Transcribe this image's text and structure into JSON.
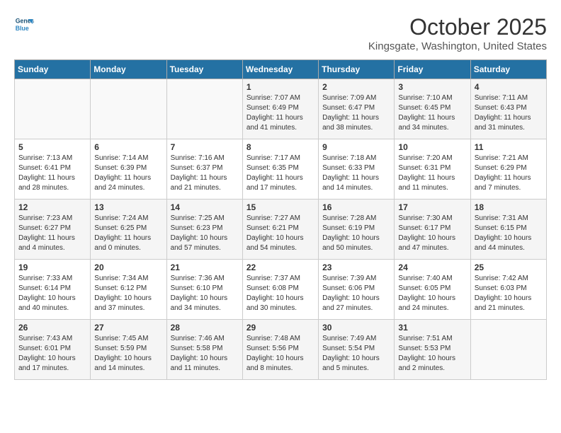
{
  "header": {
    "logo_line1": "General",
    "logo_line2": "Blue",
    "month": "October 2025",
    "location": "Kingsgate, Washington, United States"
  },
  "days_of_week": [
    "Sunday",
    "Monday",
    "Tuesday",
    "Wednesday",
    "Thursday",
    "Friday",
    "Saturday"
  ],
  "weeks": [
    [
      {
        "day": "",
        "empty": true
      },
      {
        "day": "",
        "empty": true
      },
      {
        "day": "",
        "empty": true
      },
      {
        "day": "1",
        "sunrise": "7:07 AM",
        "sunset": "6:49 PM",
        "daylight": "11 hours and 41 minutes."
      },
      {
        "day": "2",
        "sunrise": "7:09 AM",
        "sunset": "6:47 PM",
        "daylight": "11 hours and 38 minutes."
      },
      {
        "day": "3",
        "sunrise": "7:10 AM",
        "sunset": "6:45 PM",
        "daylight": "11 hours and 34 minutes."
      },
      {
        "day": "4",
        "sunrise": "7:11 AM",
        "sunset": "6:43 PM",
        "daylight": "11 hours and 31 minutes."
      }
    ],
    [
      {
        "day": "5",
        "sunrise": "7:13 AM",
        "sunset": "6:41 PM",
        "daylight": "11 hours and 28 minutes."
      },
      {
        "day": "6",
        "sunrise": "7:14 AM",
        "sunset": "6:39 PM",
        "daylight": "11 hours and 24 minutes."
      },
      {
        "day": "7",
        "sunrise": "7:16 AM",
        "sunset": "6:37 PM",
        "daylight": "11 hours and 21 minutes."
      },
      {
        "day": "8",
        "sunrise": "7:17 AM",
        "sunset": "6:35 PM",
        "daylight": "11 hours and 17 minutes."
      },
      {
        "day": "9",
        "sunrise": "7:18 AM",
        "sunset": "6:33 PM",
        "daylight": "11 hours and 14 minutes."
      },
      {
        "day": "10",
        "sunrise": "7:20 AM",
        "sunset": "6:31 PM",
        "daylight": "11 hours and 11 minutes."
      },
      {
        "day": "11",
        "sunrise": "7:21 AM",
        "sunset": "6:29 PM",
        "daylight": "11 hours and 7 minutes."
      }
    ],
    [
      {
        "day": "12",
        "sunrise": "7:23 AM",
        "sunset": "6:27 PM",
        "daylight": "11 hours and 4 minutes."
      },
      {
        "day": "13",
        "sunrise": "7:24 AM",
        "sunset": "6:25 PM",
        "daylight": "11 hours and 0 minutes."
      },
      {
        "day": "14",
        "sunrise": "7:25 AM",
        "sunset": "6:23 PM",
        "daylight": "10 hours and 57 minutes."
      },
      {
        "day": "15",
        "sunrise": "7:27 AM",
        "sunset": "6:21 PM",
        "daylight": "10 hours and 54 minutes."
      },
      {
        "day": "16",
        "sunrise": "7:28 AM",
        "sunset": "6:19 PM",
        "daylight": "10 hours and 50 minutes."
      },
      {
        "day": "17",
        "sunrise": "7:30 AM",
        "sunset": "6:17 PM",
        "daylight": "10 hours and 47 minutes."
      },
      {
        "day": "18",
        "sunrise": "7:31 AM",
        "sunset": "6:15 PM",
        "daylight": "10 hours and 44 minutes."
      }
    ],
    [
      {
        "day": "19",
        "sunrise": "7:33 AM",
        "sunset": "6:14 PM",
        "daylight": "10 hours and 40 minutes."
      },
      {
        "day": "20",
        "sunrise": "7:34 AM",
        "sunset": "6:12 PM",
        "daylight": "10 hours and 37 minutes."
      },
      {
        "day": "21",
        "sunrise": "7:36 AM",
        "sunset": "6:10 PM",
        "daylight": "10 hours and 34 minutes."
      },
      {
        "day": "22",
        "sunrise": "7:37 AM",
        "sunset": "6:08 PM",
        "daylight": "10 hours and 30 minutes."
      },
      {
        "day": "23",
        "sunrise": "7:39 AM",
        "sunset": "6:06 PM",
        "daylight": "10 hours and 27 minutes."
      },
      {
        "day": "24",
        "sunrise": "7:40 AM",
        "sunset": "6:05 PM",
        "daylight": "10 hours and 24 minutes."
      },
      {
        "day": "25",
        "sunrise": "7:42 AM",
        "sunset": "6:03 PM",
        "daylight": "10 hours and 21 minutes."
      }
    ],
    [
      {
        "day": "26",
        "sunrise": "7:43 AM",
        "sunset": "6:01 PM",
        "daylight": "10 hours and 17 minutes."
      },
      {
        "day": "27",
        "sunrise": "7:45 AM",
        "sunset": "5:59 PM",
        "daylight": "10 hours and 14 minutes."
      },
      {
        "day": "28",
        "sunrise": "7:46 AM",
        "sunset": "5:58 PM",
        "daylight": "10 hours and 11 minutes."
      },
      {
        "day": "29",
        "sunrise": "7:48 AM",
        "sunset": "5:56 PM",
        "daylight": "10 hours and 8 minutes."
      },
      {
        "day": "30",
        "sunrise": "7:49 AM",
        "sunset": "5:54 PM",
        "daylight": "10 hours and 5 minutes."
      },
      {
        "day": "31",
        "sunrise": "7:51 AM",
        "sunset": "5:53 PM",
        "daylight": "10 hours and 2 minutes."
      },
      {
        "day": "",
        "empty": true
      }
    ]
  ],
  "labels": {
    "sunrise_prefix": "Sunrise: ",
    "sunset_prefix": "Sunset: ",
    "daylight_prefix": "Daylight: "
  }
}
